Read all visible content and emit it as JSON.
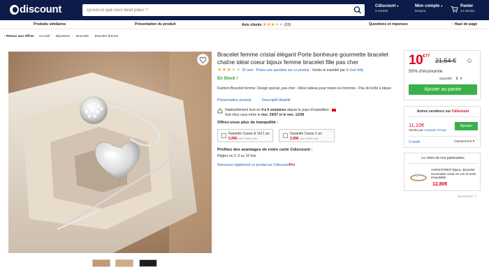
{
  "header": {
    "logo_text": "discount",
    "search_placeholder": "Qu'est-ce que vous ferait plaisr ?",
    "account_cdiscount": {
      "title": "Cdiscount",
      "sub": "à volonté"
    },
    "account": {
      "title": "Mon compte",
      "sub": "Bonjour"
    },
    "cart": {
      "title": "Panier",
      "sub": "24 articles"
    }
  },
  "nav": {
    "similar": "Produits similaires",
    "presentation": "Présentation du produit",
    "reviews": "Avis clients",
    "reviews_count": "(20)",
    "qa": "Questions et réponses",
    "top": "Haut de page"
  },
  "breadcrumb": {
    "back": "Retour aux offres",
    "items": [
      "Accueil",
      "Bijouterie",
      "Bracelet",
      "Bracelet femme"
    ]
  },
  "product": {
    "title": "Bracelet femme cristal élégant Porte bonheure gourmette bracelet chaîne idéal coeur bijoux femme bracelet fille pas cher",
    "rating": 3,
    "rating_max": 5,
    "reviews_link": "20 avis",
    "question_link": "Posez une question sur ce produit",
    "seller_text": "Vendu et expédié par",
    "seller_name": "In love folly",
    "stock": "En Stock !",
    "description": "Fashion Bracelet femme: Design spécial, pas cher - Idéal cadeau pour toutes les femmes - Pas de boîte à bijoux",
    "tab_presentation": "Présentation produit",
    "tab_desc": "Descriptif détaillé",
    "shipping_line1_a": "Habituellement livré en",
    "shipping_line1_b": "4 à 6 semaines",
    "shipping_line1_c": "depuis le pays d'expédition :",
    "shipping_line2_a": "Soit chez vous entre le",
    "shipping_line2_b": "mer. 29/07 et le mer. 12/08",
    "tranquility_title": "Offrez-vous plus de tranquilité :",
    "guarantees": [
      {
        "label": "Garantie Casse & Vol 1 an",
        "price": "5,99€",
        "sub": "soit 0,50€ mois"
      },
      {
        "label": "Garantie Casse 1 an",
        "price": "3,99€",
        "sub": "soit 0,33€ mois"
      }
    ],
    "advantages_title": "Profitez des avantages de notre carte Cdiscount :",
    "advantages_text": "Réglez en 3, 5 ou 10 fois",
    "advantages_link": "Retrouvez également ce produit sur Cdiscount",
    "advantages_pro": "Pro"
  },
  "pricebox": {
    "price_int": "10",
    "price_dec": "€77",
    "old_price": "21,54 €",
    "economy": "50% d'économie",
    "qty_label": "Quantité",
    "qty_value": "1",
    "add_to_cart": "Ajouter au panier"
  },
  "sellers": {
    "title_a": "Autres vendeurs sur ",
    "title_b": "Cdiscount",
    "price": "11,10€",
    "by_label": "Vendu par",
    "by_name": "Caravan Group",
    "button": "Ajouter",
    "count": "2 neufs",
    "sort": "Classement"
  },
  "partners": {
    "title": "Le choix de nos partenaires",
    "name": "AURISTORE® Bijoux -Bracelet Gourmette coeur en cuir et acier inoxydable",
    "price": "12,80€",
    "sponsored": "Sponsorisé"
  },
  "colors": {
    "navy": "#0c1b47",
    "red": "#e0001a",
    "green": "#3ab04a",
    "link": "#1a66c2"
  }
}
